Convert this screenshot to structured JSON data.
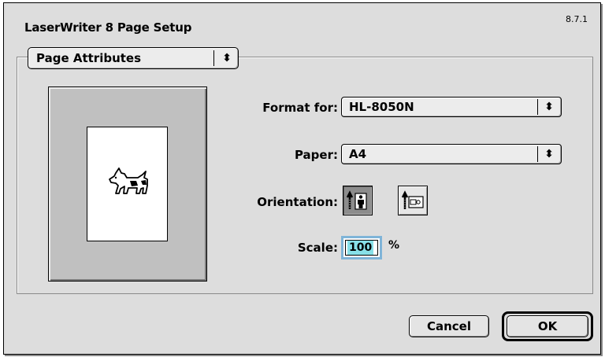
{
  "dialog": {
    "title": "LaserWriter 8 Page Setup",
    "version": "8.7.1"
  },
  "group": {
    "selected_panel": "Page Attributes"
  },
  "preview": {
    "icon": "dogcow-icon"
  },
  "fields": {
    "format_for": {
      "label": "Format for:",
      "value": "HL-8050N"
    },
    "paper": {
      "label": "Paper:",
      "value": "A4"
    },
    "orientation": {
      "label": "Orientation:",
      "options": [
        "portrait",
        "landscape"
      ],
      "selected": "portrait"
    },
    "scale": {
      "label": "Scale:",
      "value": "100",
      "unit": "%"
    }
  },
  "buttons": {
    "cancel": "Cancel",
    "ok": "OK"
  },
  "colors": {
    "focus_ring": "#7fb4d8",
    "selection_highlight": "#88e0e8"
  }
}
